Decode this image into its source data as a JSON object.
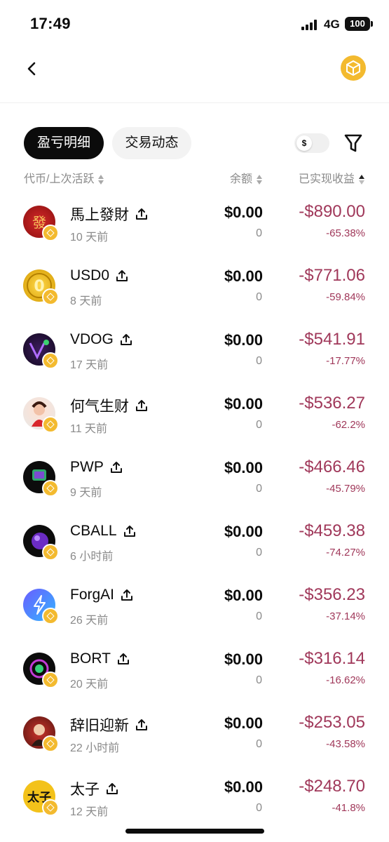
{
  "status_bar": {
    "time": "17:49",
    "network": "4G",
    "battery": "100"
  },
  "filters": {
    "tabs": [
      {
        "label": "盈亏明细",
        "active": true
      },
      {
        "label": "交易动态",
        "active": false
      }
    ],
    "currency_toggle": "$"
  },
  "columns": {
    "token": "代币/上次活跃",
    "balance": "余额",
    "realized_pnl": "已实现收益"
  },
  "colors": {
    "loss": "#a0385a",
    "accent": "#f3ba2f"
  },
  "tokens": [
    {
      "name": "馬上發財",
      "last_active": "10 天前",
      "balance": "$0.00",
      "qty": "0",
      "pnl": "-$890.00",
      "pct": "-65.38%"
    },
    {
      "name": "USD0",
      "last_active": "8 天前",
      "balance": "$0.00",
      "qty": "0",
      "pnl": "-$771.06",
      "pct": "-59.84%"
    },
    {
      "name": "VDOG",
      "last_active": "17 天前",
      "balance": "$0.00",
      "qty": "0",
      "pnl": "-$541.91",
      "pct": "-17.77%"
    },
    {
      "name": "何气生财",
      "last_active": "11 天前",
      "balance": "$0.00",
      "qty": "0",
      "pnl": "-$536.27",
      "pct": "-62.2%"
    },
    {
      "name": "PWP",
      "last_active": "9 天前",
      "balance": "$0.00",
      "qty": "0",
      "pnl": "-$466.46",
      "pct": "-45.79%"
    },
    {
      "name": "CBALL",
      "last_active": "6 小时前",
      "balance": "$0.00",
      "qty": "0",
      "pnl": "-$459.38",
      "pct": "-74.27%"
    },
    {
      "name": "ForgAI",
      "last_active": "26 天前",
      "balance": "$0.00",
      "qty": "0",
      "pnl": "-$356.23",
      "pct": "-37.14%"
    },
    {
      "name": "BORT",
      "last_active": "20 天前",
      "balance": "$0.00",
      "qty": "0",
      "pnl": "-$316.14",
      "pct": "-16.62%"
    },
    {
      "name": "辞旧迎新",
      "last_active": "22 小时前",
      "balance": "$0.00",
      "qty": "0",
      "pnl": "-$253.05",
      "pct": "-43.58%"
    },
    {
      "name": "太子",
      "last_active": "12 天前",
      "balance": "$0.00",
      "qty": "0",
      "pnl": "-$248.70",
      "pct": "-41.8%"
    }
  ]
}
